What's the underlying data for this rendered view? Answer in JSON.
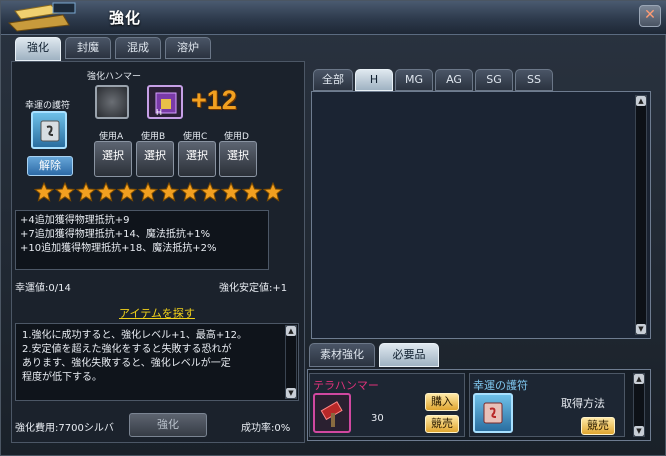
{
  "window": {
    "title": "強化",
    "close_label": "✕"
  },
  "tabs": [
    "強化",
    "封魔",
    "混成",
    "溶炉"
  ],
  "left": {
    "hammer_label": "強化ハンマー",
    "lucky_label": "幸運の護符",
    "enhance_level": "+12",
    "release_label": "解除",
    "use_labels": [
      "使用A",
      "使用B",
      "使用C",
      "使用D"
    ],
    "select_label": "選択",
    "star_count": 12,
    "effects": [
      "+4追加獲得物理抵抗+9",
      "+7追加獲得物理抵抗+14、魔法抵抗+1%",
      "+10追加獲得物理抵抗+18、魔法抵抗+2%"
    ],
    "luck_value": "幸運値:0/14",
    "stability_value": "強化安定値:+1",
    "find_item_link": "アイテムを探す",
    "description": [
      "1.強化に成功すると、強化レベル+1、最高+12。",
      "2.安定値を超えた強化をすると失敗する恐れが",
      "あります、強化失敗すると、強化レベルが一定",
      "程度が低下する。"
    ],
    "cost_label": "強化費用:7700シルバ",
    "enhance_button": "強化",
    "success_rate": "成功率:0%"
  },
  "right": {
    "filter_tabs": [
      "全部",
      "H",
      "MG",
      "AG",
      "SG",
      "SS"
    ],
    "active_filter": "H",
    "bottom_tabs": [
      "素材強化",
      "必要品"
    ],
    "materials": [
      {
        "name": "テラハンマー",
        "count": "30",
        "buttons": [
          "購入",
          "競売"
        ],
        "name_color": "#e0327a"
      },
      {
        "name": "幸運の護符",
        "method_label": "取得方法",
        "buttons": [
          "競売"
        ],
        "name_color": "#7fc8f0"
      }
    ]
  },
  "colors": {
    "accent_gold": "#f2a020",
    "link_yellow": "#f2d21a"
  }
}
